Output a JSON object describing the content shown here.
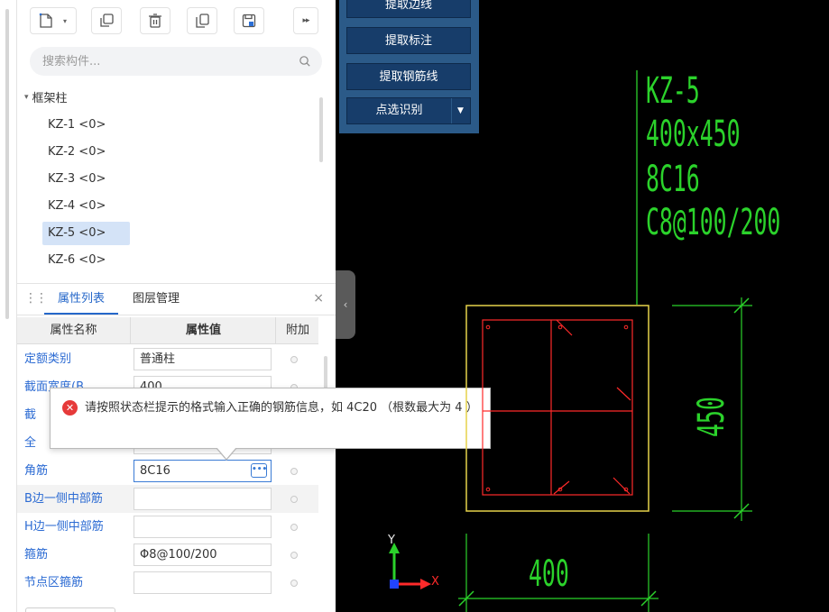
{
  "toolbar": {
    "buttons": [
      "new-component-icon",
      "dropdown-arrow-icon",
      "copy-icon",
      "delete-icon",
      "copy-to-floor-icon",
      "save-as-icon"
    ],
    "more_label": "▸▸"
  },
  "search": {
    "placeholder": "搜索构件...",
    "value": ""
  },
  "tree": {
    "root_label": "框架柱",
    "items": [
      {
        "label": "KZ-1 <0>"
      },
      {
        "label": "KZ-2 <0>"
      },
      {
        "label": "KZ-3 <0>"
      },
      {
        "label": "KZ-4 <0>"
      },
      {
        "label": "KZ-5 <0>",
        "selected": true
      },
      {
        "label": "KZ-6 <0>"
      }
    ]
  },
  "tabs": {
    "active": "属性列表",
    "inactive": "图层管理",
    "close": "×"
  },
  "props": {
    "header": {
      "name": "属性名称",
      "value": "属性值",
      "extra": "附加"
    },
    "rows": [
      {
        "name": "定额类别",
        "value": "普通柱"
      },
      {
        "name": "截面宽度(B",
        "value": "400"
      },
      {
        "name": "截",
        "value": ""
      },
      {
        "name": "全",
        "value": ""
      },
      {
        "name": "角筋",
        "value": "8C16",
        "focus": true
      },
      {
        "name": "B边一侧中部筋",
        "value": ""
      },
      {
        "name": "H边一侧中部筋",
        "value": ""
      },
      {
        "name": "箍筋",
        "value": "Φ8@100/200"
      },
      {
        "name": "节点区箍筋",
        "value": ""
      }
    ]
  },
  "tooltip": {
    "message": "请按照状态栏提示的格式输入正确的钢筋信息，如 4C20 （根数最大为 4 ）",
    "icon": "error-icon"
  },
  "blue_panel": {
    "buttons": [
      "提取边线",
      "提取标注",
      "提取钢筋线"
    ],
    "split_label": "点选识别"
  },
  "cad": {
    "name": "KZ-5",
    "size": "400x450",
    "main_rebar": "8C16",
    "stirrup": "C8@100/200",
    "dim_b": "400",
    "dim_h": "450",
    "axis_y": "Y",
    "axis_x": "X",
    "colors": {
      "green": "#2bd22b",
      "red": "#ff2a2a",
      "yellow": "#e6d24a",
      "background": "#000000"
    }
  }
}
